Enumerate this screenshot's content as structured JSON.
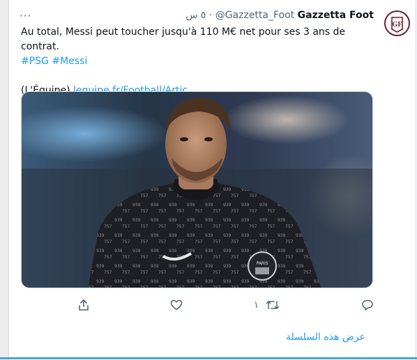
{
  "tweet": {
    "more_label": "···",
    "author_name": "Gazzetta Foot",
    "author_handle": "@Gazzetta_Foot",
    "separator": "·",
    "timestamp": "٥ س",
    "avatar_text": "GF",
    "text_line1": "Au total, Messi peut toucher jusqu'à 110 M€ net pour ses 3 ans de contrat.",
    "hashtags": [
      "#PSG",
      "#Messi"
    ],
    "source_prefix": "(L'Équipe) ",
    "link": "lequipe.fr/Football/Artic…"
  },
  "actions": {
    "reply_count": "",
    "retweet_count": "١",
    "like_count": "",
    "share_count": ""
  },
  "thread": {
    "show_thread": "عرض هذه السلسلة"
  },
  "colors": {
    "accent": "#1d9bf0",
    "avatar_border": "#6d1f2c",
    "muted": "#536471",
    "bottom_bar": "#4aa3df"
  }
}
